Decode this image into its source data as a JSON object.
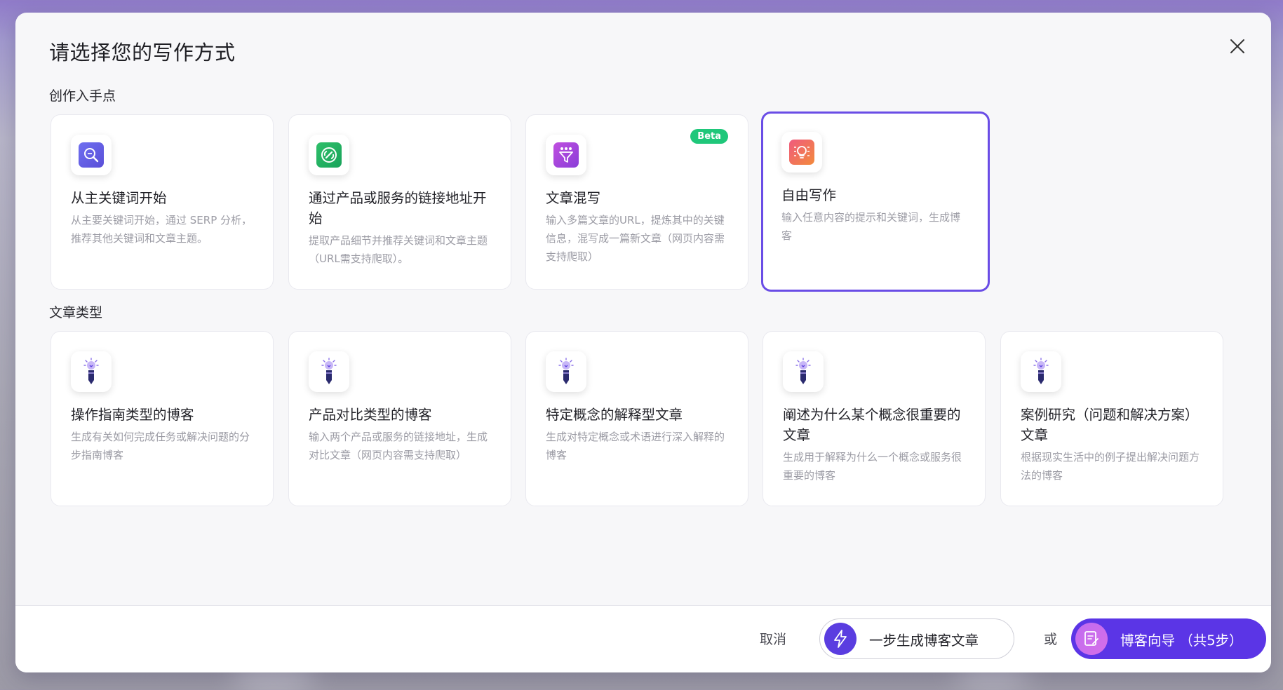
{
  "modal": {
    "title": "请选择您的写作方式"
  },
  "sections": {
    "entry_points_label": "创作入手点",
    "article_types_label": "文章类型"
  },
  "entry_points": [
    {
      "title": "从主关键词开始",
      "desc": "从主要关键词开始，通过 SERP 分析，推荐其他关键词和文章主题。",
      "icon": "keyword-search-icon",
      "selected": false
    },
    {
      "title": "通过产品或服务的链接地址开始",
      "desc": "提取产品细节并推荐关键词和文章主题（URL需支持爬取）。",
      "icon": "link-icon",
      "selected": false
    },
    {
      "title": "文章混写",
      "desc": "输入多篇文章的URL，提炼其中的关键信息，混写成一篇新文章（网页内容需支持爬取）",
      "icon": "funnel-mix-icon",
      "badge": "Beta",
      "selected": false
    },
    {
      "title": "自由写作",
      "desc": "输入任意内容的提示和关键词，生成博客",
      "icon": "idea-bulb-icon",
      "selected": true
    }
  ],
  "article_types": [
    {
      "title": "操作指南类型的博客",
      "desc": "生成有关如何完成任务或解决问题的分步指南博客",
      "icon": "lightbulb-pen-icon"
    },
    {
      "title": "产品对比类型的博客",
      "desc": "输入两个产品或服务的链接地址，生成对比文章（网页内容需支持爬取）",
      "icon": "lightbulb-pen-icon"
    },
    {
      "title": "特定概念的解释型文章",
      "desc": "生成对特定概念或术语进行深入解释的博客",
      "icon": "lightbulb-pen-icon"
    },
    {
      "title": "阐述为什么某个概念很重要的文章",
      "desc": "生成用于解释为什么一个概念或服务很重要的博客",
      "icon": "lightbulb-pen-icon"
    },
    {
      "title": "案例研究（问题和解决方案）文章",
      "desc": "根据现实生活中的例子提出解决问题方法的博客",
      "icon": "lightbulb-pen-icon"
    }
  ],
  "footer": {
    "cancel_label": "取消",
    "oneclick_label": "一步生成博客文章",
    "or_label": "或",
    "wizard_label": "博客向导 （共5步）"
  },
  "colors": {
    "accent": "#5b35e6",
    "selected_border": "#6a4de6",
    "beta_badge": "#1fc77a"
  }
}
